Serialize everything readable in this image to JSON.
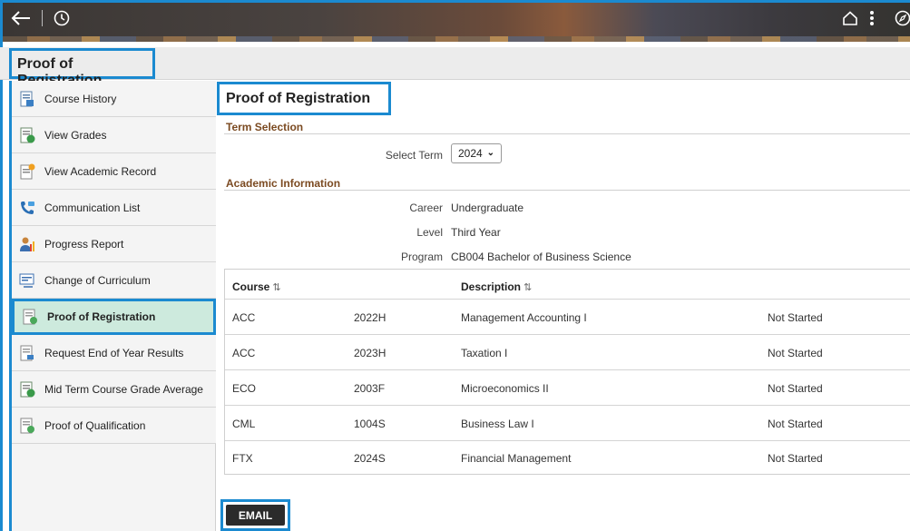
{
  "page_title": "Proof of Registration",
  "main_heading": "Proof of Registration",
  "sidebar": {
    "items": [
      {
        "label": "Course History",
        "icon": "report-icon"
      },
      {
        "label": "View Grades",
        "icon": "grades-icon"
      },
      {
        "label": "View Academic Record",
        "icon": "record-icon"
      },
      {
        "label": "Communication List",
        "icon": "communication-icon"
      },
      {
        "label": "Progress Report",
        "icon": "progress-icon"
      },
      {
        "label": "Change of Curriculum",
        "icon": "curriculum-icon"
      },
      {
        "label": "Proof of Registration",
        "icon": "document-icon"
      },
      {
        "label": "Request End of Year Results",
        "icon": "request-icon"
      },
      {
        "label": "Mid Term Course Grade Average",
        "icon": "grades-icon"
      },
      {
        "label": "Proof of Qualification",
        "icon": "document-icon"
      }
    ]
  },
  "term_selection": {
    "section_title": "Term Selection",
    "select_label": "Select Term",
    "selected_term": "2024"
  },
  "academic_info": {
    "section_title": "Academic Information",
    "career_label": "Career",
    "career_value": "Undergraduate",
    "level_label": "Level",
    "level_value": "Third Year",
    "program_label": "Program",
    "program_value": "CB004 Bachelor of Business Science"
  },
  "table": {
    "headers": {
      "course": "Course",
      "description": "Description",
      "sort_glyph": "⇅"
    },
    "rows": [
      {
        "subject": "ACC",
        "number": "2022H",
        "description": "Management Accounting I",
        "status": "Not Started"
      },
      {
        "subject": "ACC",
        "number": "2023H",
        "description": "Taxation I",
        "status": "Not Started"
      },
      {
        "subject": "ECO",
        "number": "2003F",
        "description": "Microeconomics II",
        "status": "Not Started"
      },
      {
        "subject": "CML",
        "number": "1004S",
        "description": "Business Law I",
        "status": "Not Started"
      },
      {
        "subject": "FTX",
        "number": "2024S",
        "description": "Financial Management",
        "status": "Not Started"
      }
    ]
  },
  "email_button": "EMAIL",
  "colors": {
    "highlight": "#1b8ad0",
    "section_title": "#7b4a21",
    "active_item": "#cdeadd"
  }
}
